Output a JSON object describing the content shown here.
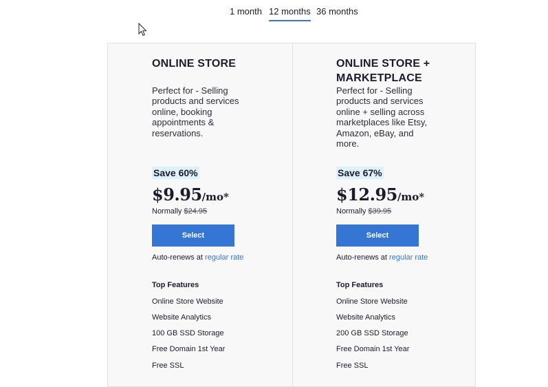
{
  "billing_tabs": [
    "1 month",
    "12 months",
    "36 months"
  ],
  "selected_tab": "12 months",
  "plans": [
    {
      "title": "ONLINE STORE",
      "description": "Perfect for - Selling products and services online, booking appointments & reservations.",
      "save": "Save 60%",
      "price": "$9.95",
      "per": "/mo*",
      "normally_label": "Normally",
      "normal_price": "$24.95",
      "button": "Select",
      "renew_text": "Auto-renews at",
      "renew_link": "regular rate",
      "features_title": "Top Features",
      "features": [
        "Online Store Website",
        "Website Analytics",
        "100 GB SSD Storage",
        "Free Domain 1st Year",
        "Free SSL"
      ]
    },
    {
      "title": "ONLINE STORE + MARKETPLACE",
      "description": "Perfect for - Selling products and services online + selling across marketplaces like Etsy, Amazon, eBay, and more.",
      "save": "Save 67%",
      "price": "$12.95",
      "per": "/mo*",
      "normally_label": "Normally",
      "normal_price": "$39.95",
      "button": "Select",
      "renew_text": "Auto-renews at",
      "renew_link": "regular rate",
      "features_title": "Top Features",
      "features": [
        "Online Store Website",
        "Website Analytics",
        "200 GB SSD Storage",
        "Free Domain 1st Year",
        "Free SSL"
      ]
    }
  ],
  "colors": {
    "accent": "#3575d3",
    "save_bg": "#dff1f8",
    "card_bg": "#f8f8f8"
  }
}
